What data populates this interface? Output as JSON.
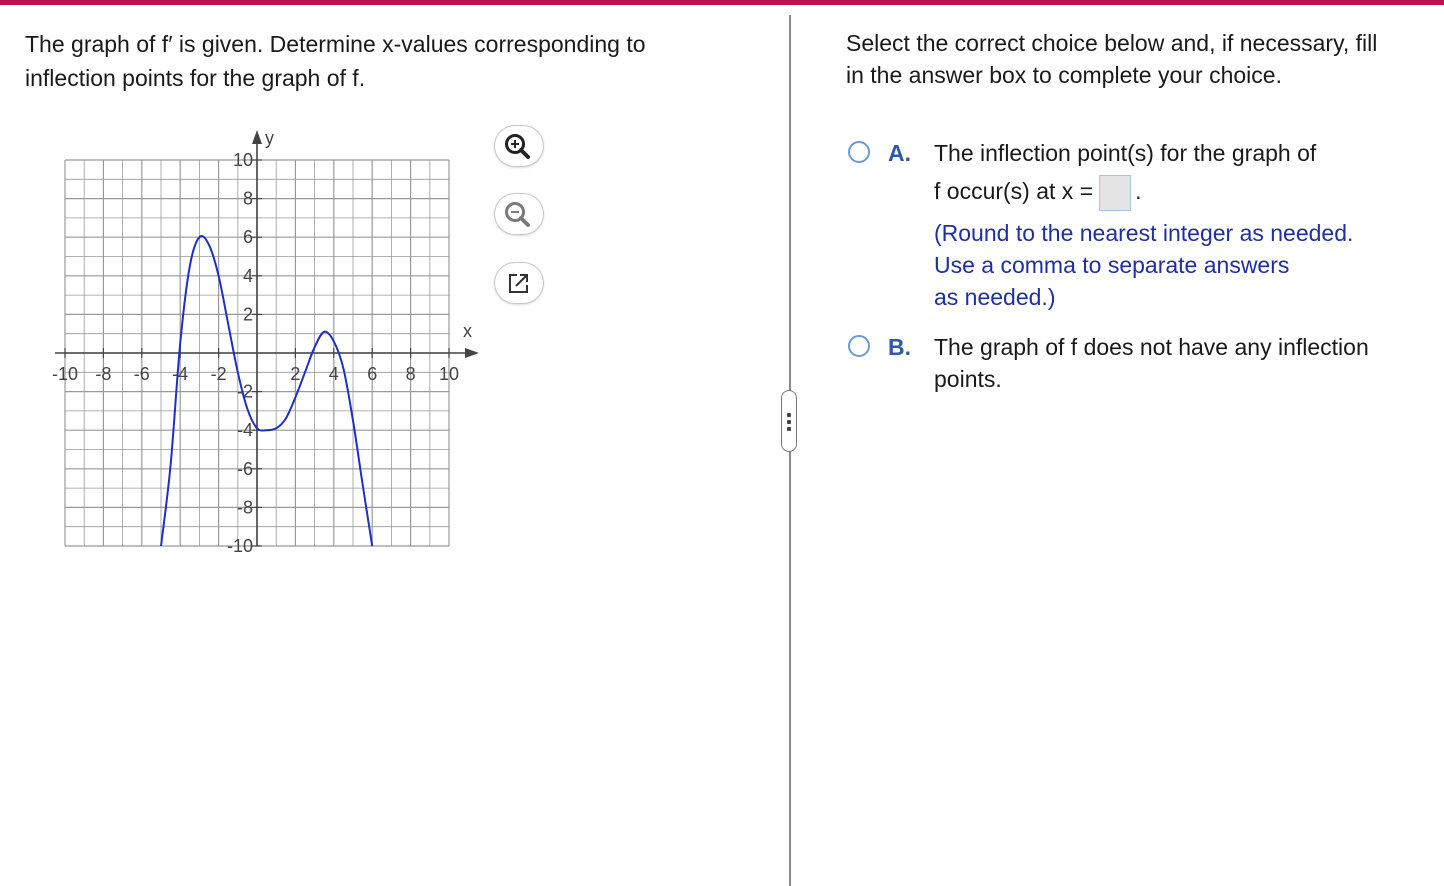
{
  "question": {
    "line1": "The graph of f′ is given. Determine x-values corresponding to",
    "line2": "inflection points for the graph of f."
  },
  "graph": {
    "x_axis_label": "x",
    "y_axis_label": "y",
    "x_tick_labels": [
      "-10",
      "-8",
      "-6",
      "-4",
      "-2",
      "2",
      "4",
      "6",
      "8",
      "10"
    ],
    "y_tick_labels": [
      "10",
      "8",
      "6",
      "4",
      "2",
      "-2",
      "-4",
      "-6",
      "-8",
      "-10"
    ]
  },
  "chart_data": {
    "type": "line",
    "xlabel": "x",
    "ylabel": "y",
    "xlim": [
      -10,
      10
    ],
    "ylim": [
      -10,
      10
    ],
    "grid": true,
    "series": [
      {
        "x": [
          -5,
          -4.5,
          -4,
          -3.5,
          -3,
          -2.5,
          -2,
          -1.5,
          -1,
          -0.5,
          0,
          0.5,
          1,
          1.5,
          2,
          2.5,
          3,
          3.5,
          4,
          4.5,
          5,
          5.5,
          6
        ],
        "values": [
          -10,
          -5.8,
          0.5,
          4.5,
          6,
          5.6,
          4,
          1.5,
          -1,
          -2.9,
          -3.9,
          -4,
          -3.9,
          -3.4,
          -2.3,
          -1,
          0.3,
          1.1,
          0.6,
          -0.8,
          -3.5,
          -6.8,
          -10
        ]
      }
    ],
    "line_color": "#1d2fc4"
  },
  "tools": {
    "zoom_in_icon": "zoom-in-icon",
    "zoom_out_icon": "zoom-out-icon",
    "popout_icon": "external-link-icon"
  },
  "instruction": {
    "line1": "Select the correct choice below and, if necessary, fill",
    "line2": "in the answer box to complete your choice."
  },
  "choices": {
    "a": {
      "letter": "A.",
      "line1": "The inflection point(s) for the graph of",
      "line2_prefix": "f occur(s) at x =",
      "line2_suffix": ".",
      "answer_value": "",
      "hint1": "(Round to the nearest integer as needed.",
      "hint2": "Use a comma to separate answers",
      "hint3": "as needed.)"
    },
    "b": {
      "letter": "B.",
      "line1": "The graph of f does not have any inflection",
      "line2": "points."
    }
  },
  "colors": {
    "accent_bar": "#b5174f",
    "curve": "#1d2fc4",
    "choice_letter": "#2c5aa8",
    "hint": "#1e2fa5"
  }
}
